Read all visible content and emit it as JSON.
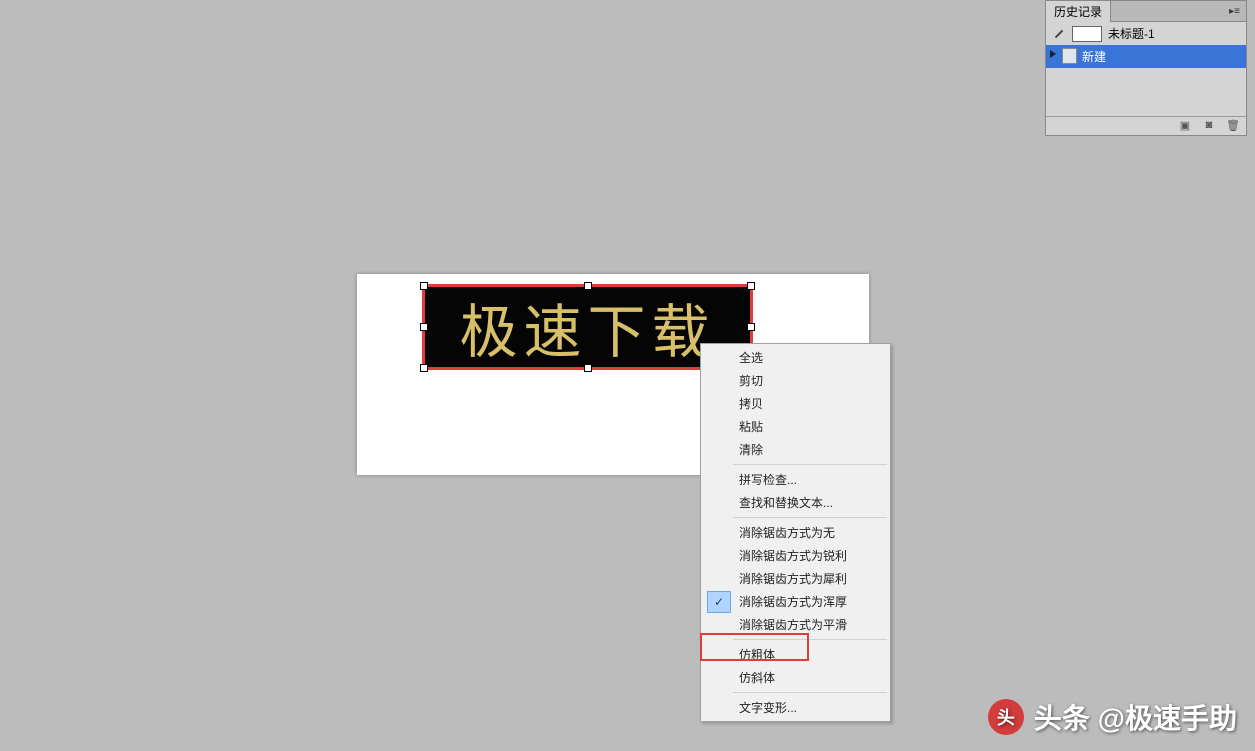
{
  "canvas": {
    "text": "极速下载"
  },
  "context_menu": {
    "items": [
      {
        "label": "全选"
      },
      {
        "label": "剪切"
      },
      {
        "label": "拷贝"
      },
      {
        "label": "粘贴"
      },
      {
        "label": "清除"
      },
      {
        "sep": true
      },
      {
        "label": "拼写检查..."
      },
      {
        "label": "查找和替换文本..."
      },
      {
        "sep": true
      },
      {
        "label": "消除锯齿方式为无"
      },
      {
        "label": "消除锯齿方式为锐利"
      },
      {
        "label": "消除锯齿方式为犀利"
      },
      {
        "label": "消除锯齿方式为浑厚",
        "checked": true
      },
      {
        "label": "消除锯齿方式为平滑"
      },
      {
        "sep": true
      },
      {
        "label": "仿粗体",
        "highlight": true
      },
      {
        "label": "仿斜体"
      },
      {
        "sep": true
      },
      {
        "label": "文字变形..."
      }
    ]
  },
  "history_panel": {
    "tab": "历史记录",
    "document": "未标题-1",
    "step": "新建"
  },
  "watermark": {
    "logo_text": "头",
    "text": "头条 @极速手助"
  }
}
